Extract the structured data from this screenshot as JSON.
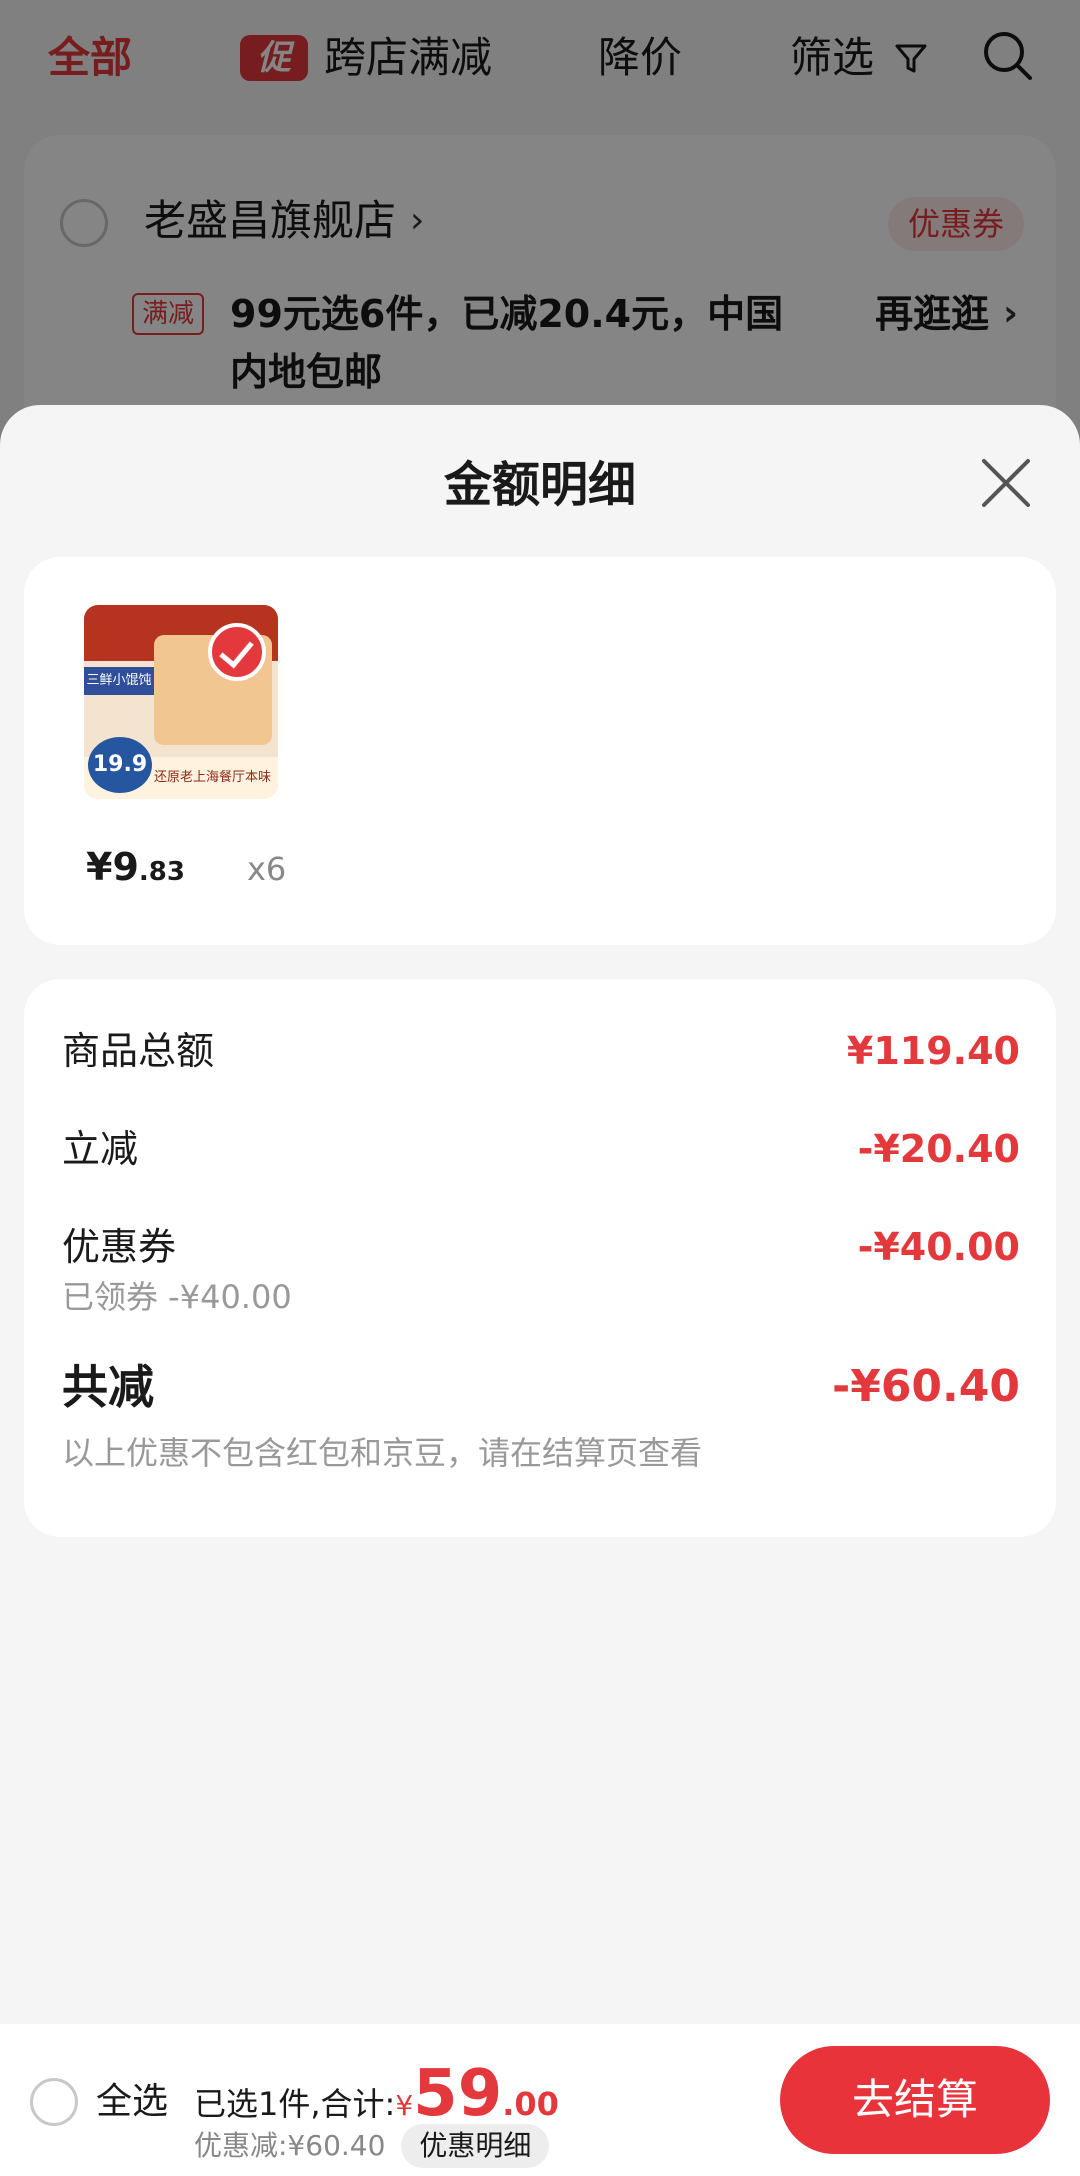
{
  "top_tabs": {
    "all": "全部",
    "promo_badge": "促",
    "cross_store": "跨店满减",
    "price_drop": "降价",
    "filter": "筛选"
  },
  "store": {
    "name": "老盛昌旗舰店",
    "coupon": "优惠券",
    "promo_tag": "满减",
    "promo_text": "99元选6件，已减20.4元，中国内地包邮",
    "more": "再逛逛"
  },
  "sheet": {
    "title": "金额明细",
    "product": {
      "price_int": "¥9",
      "price_dec": ".83",
      "quantity": "x6",
      "thumb_label": "三鲜小馄饨",
      "thumb_badge": "19.9",
      "thumb_slogan": "还原老上海餐厅本味"
    },
    "summary": {
      "goods_total_label": "商品总额",
      "goods_total_value": "¥119.40",
      "instant_label": "立减",
      "instant_value": "-¥20.40",
      "coupon_label": "优惠券",
      "coupon_value": "-¥40.00",
      "coupon_note": "已领券 -¥40.00",
      "total_label": "共减",
      "total_value": "-¥60.40",
      "total_note": "以上优惠不包含红包和京豆，请在结算页查看"
    }
  },
  "bottom_bar": {
    "select_all": "全选",
    "selected_text": "已选1件,合计:",
    "currency": "¥",
    "amount_int": "59",
    "amount_dec": ".00",
    "discount_text": "优惠减:¥60.40",
    "detail_button": "优惠明细",
    "checkout_button": "去结算"
  }
}
